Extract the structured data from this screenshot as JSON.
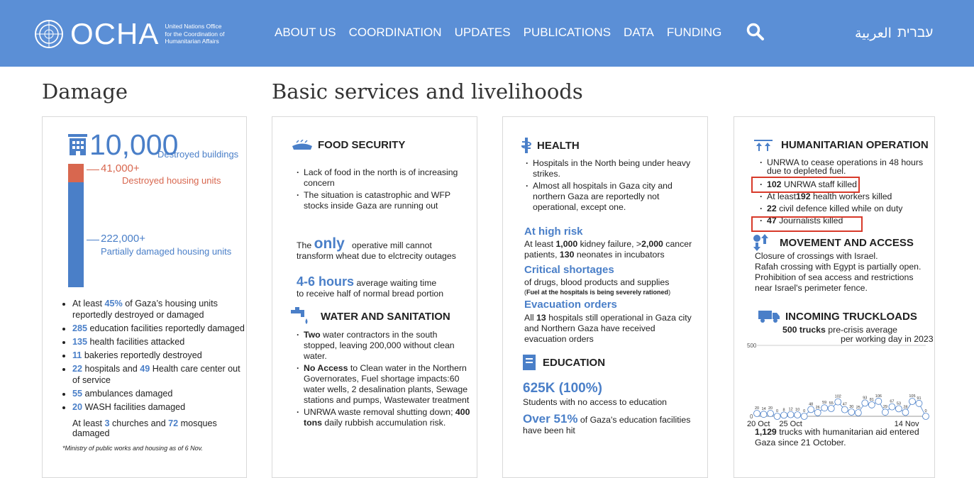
{
  "header": {
    "logo_text": "OCHA",
    "logo_subtitle": [
      "United Nations Office",
      "for the Coordination of",
      "Humanitarian Affairs"
    ],
    "nav": [
      "ABOUT US",
      "COORDINATION",
      "UPDATES",
      "PUBLICATIONS",
      "DATA",
      "FUNDING"
    ],
    "languages": [
      "עברית",
      "العربية"
    ],
    "bg_color": "#5b8fd6"
  },
  "sections": {
    "damage_title": "Damage",
    "services_title": "Basic services and livelihoods"
  },
  "damage": {
    "buildings_value": "10,000",
    "buildings_label": "Destroyed buildings",
    "destroyed_units_value": "41,000+",
    "destroyed_units_label": "Destroyed housing units",
    "partial_units_value": "222,000+",
    "partial_units_label": "Partially damaged housing units",
    "bullets": [
      {
        "pre": "At least ",
        "num": "45%",
        "post": " of Gaza’s housing units reportedly destroyed or damaged"
      },
      {
        "pre": "",
        "num": "285",
        "post": " education facilities reportedly damaged"
      },
      {
        "pre": "",
        "num": "135",
        "post": " health facilities attacked"
      },
      {
        "pre": "",
        "num": "11",
        "post": " bakeries reportedly destroyed"
      },
      {
        "pre": "",
        "num": "22",
        "post": " hospitals and ",
        "num2": "49",
        "post2": " Health care center out of service"
      },
      {
        "pre": "",
        "num": "55",
        "post": " ambulances damaged"
      },
      {
        "pre": "",
        "num": "20",
        "post": " WASH facilities damaged"
      }
    ],
    "churches_text": {
      "pre": "At least ",
      "num": "3",
      "mid": " churches and ",
      "num2": "72",
      "post": " mosques damaged"
    },
    "footnote": "*Ministry of public works and housing as of 6 Nov."
  },
  "food": {
    "title": "FOOD SECURITY",
    "bullets": [
      "Lack of food in the north is of increasing concern",
      "The situation is catastrophic and WFP stocks inside Gaza are running out"
    ],
    "mill": {
      "pre": "The",
      "big": "only",
      "post": "operative mill cannot transform wheat due to elctrecity outages"
    },
    "wait": {
      "big": "4-6 hours",
      "post": "average waiting time",
      "line2": "to receive half of normal bread portion"
    }
  },
  "water": {
    "title": "WATER AND SANITATION",
    "bullets": [
      {
        "bold": "Two",
        "text": " water contractors in the south stopped, leaving 200,000 without clean water."
      },
      {
        "bold": "No Access",
        "text": " to Clean water in the Northern Governorates, Fuel shortage impacts:60 water wells, 2 desalination plants, Sewage stations and pumps, Wastewater treatment"
      },
      {
        "bold": "",
        "text": "UNRWA waste removal shutting down; ",
        "bold2": "400 tons",
        "text2": " daily rubbish accumulation risk."
      }
    ]
  },
  "health": {
    "title": "HEALTH",
    "bullets": [
      "Hospitals in the North being under heavy strikes.",
      "Almost all hospitals in Gaza city and northern Gaza are reportedly not operational, except one."
    ],
    "risk_title": "At high risk",
    "risk": {
      "pre": "At least ",
      "b1": "1,000",
      "m1": " kidney failure, >",
      "b2": "2,000",
      "m2": " cancer patients, ",
      "b3": "130",
      "post": " neonates in incubators"
    },
    "short_title": "Critical shortages",
    "short_text": "of drugs, blood products and supplies",
    "short_note": "Fuel at the hospitals is being severely rationed",
    "evac_title": "Evacuation orders",
    "evac": {
      "pre": "All ",
      "b": "13",
      "post": " hospitals still operational in Gaza city and Northern Gaza have received evacuation orders"
    }
  },
  "education": {
    "title": "EDUCATION",
    "big": "625K (100%)",
    "big_text": "Students with no access to education",
    "over_pre": "Over ",
    "over_big": "51%",
    "over_text": " of Gaza's education facilities have been hit"
  },
  "humanitarian": {
    "title": "HUMANITARIAN OPERATION",
    "bullets": [
      {
        "b": "",
        "t": "UNRWA to cease operations in 48 hours due to depleted fuel."
      },
      {
        "b": "102",
        "t": " UNRWA staff killed"
      },
      {
        "b": "192",
        "t": " health workers killed",
        "pre": "At least"
      },
      {
        "b": "22",
        "t": " civil defence killed while on duty"
      },
      {
        "b": "47",
        "t": " Journalists killed"
      }
    ]
  },
  "movement": {
    "title": "MOVEMENT AND ACCESS",
    "lines": [
      "Closure of crossings with Israel.",
      "Rafah crossing with Egypt is partially open.",
      "Prohibition of sea access and restrictions",
      "near Israel's perimeter fence."
    ]
  },
  "trucks": {
    "title": "INCOMING TRUCKLOADS",
    "ref_bold": "500 trucks",
    "ref_text": "pre-crisis average",
    "ref_text2": "per working day in 2023",
    "total_bold": "1,129",
    "total_text": " trucks with humanitarian aid entered Gaza since 21 October."
  },
  "chart_data": {
    "type": "line",
    "x": [
      "21 Oct",
      "22 Oct",
      "23 Oct",
      "24 Oct",
      "25 Oct",
      "26 Oct",
      "27 Oct",
      "28 Oct",
      "29 Oct",
      "30 Oct",
      "31 Oct",
      "1 Nov",
      "2 Nov",
      "3 Nov",
      "4 Nov",
      "5 Nov",
      "6 Nov",
      "7 Nov",
      "8 Nov",
      "9 Nov",
      "10 Nov",
      "11 Nov",
      "12 Nov",
      "13 Nov",
      "14 Nov",
      "15 Nov"
    ],
    "values": [
      20,
      14,
      20,
      0,
      8,
      12,
      10,
      0,
      48,
      26,
      59,
      55,
      102,
      47,
      30,
      25,
      93,
      81,
      106,
      29,
      67,
      53,
      28,
      105,
      91,
      0
    ],
    "xticks": [
      "20 Oct",
      "25 Oct",
      "14 Nov"
    ],
    "yticks": [
      "0",
      "500"
    ],
    "reference_line": 500,
    "ylim": [
      0,
      500
    ],
    "grid": false,
    "colors": {
      "series": "#4a7fc8",
      "reference": "#cccccc"
    }
  }
}
